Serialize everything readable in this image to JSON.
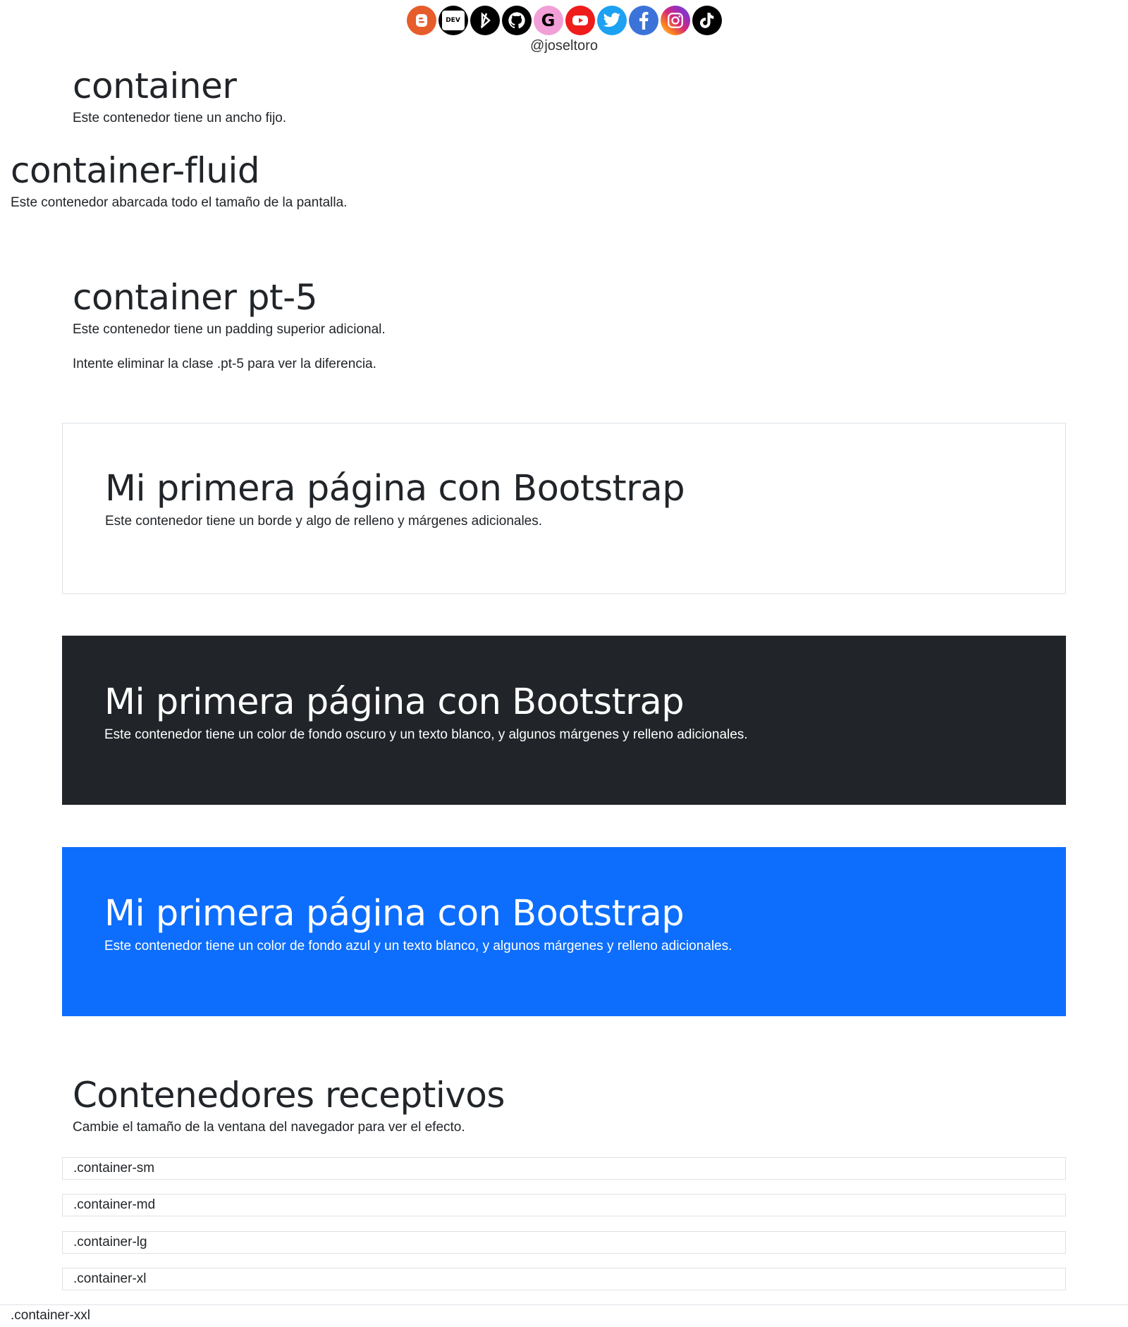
{
  "social": {
    "icons": [
      {
        "name": "blogger-icon",
        "color": "#e65c2b"
      },
      {
        "name": "dev-icon",
        "color": "#000000",
        "text": "DEV"
      },
      {
        "name": "codepen-slash-icon",
        "color": "#000000"
      },
      {
        "name": "github-icon",
        "color": "#000000"
      },
      {
        "name": "google-icon",
        "color": "#f29fd8",
        "text": "G"
      },
      {
        "name": "youtube-icon",
        "color": "#ee1c1b"
      },
      {
        "name": "twitter-icon",
        "color": "#1da1f2"
      },
      {
        "name": "facebook-icon",
        "color": "#3b73d9"
      },
      {
        "name": "instagram-icon",
        "color": "#d62976"
      },
      {
        "name": "tiktok-icon",
        "color": "#000000"
      }
    ],
    "handle": "@joseltoro"
  },
  "sections": {
    "container": {
      "title": "container",
      "text": "Este contenedor tiene un ancho fijo."
    },
    "fluid": {
      "title": "container-fluid",
      "text": "Este contenedor abarcada todo el tamaño de la pantalla."
    },
    "pt5": {
      "title": "container pt-5",
      "text1": "Este contenedor tiene un padding superior adicional.",
      "text2": "Intente eliminar la clase .pt-5 para ver la diferencia."
    },
    "bordered": {
      "title": "Mi primera página con Bootstrap",
      "text": "Este contenedor tiene un borde y algo de relleno y márgenes adicionales."
    },
    "dark": {
      "title": "Mi primera página con Bootstrap",
      "text": "Este contenedor tiene un color de fondo oscuro y un texto blanco, y algunos márgenes y relleno adicionales."
    },
    "blue": {
      "title": "Mi primera página con Bootstrap",
      "text": "Este contenedor tiene un color de fondo azul y un texto blanco, y algunos márgenes y relleno adicionales."
    },
    "responsive": {
      "title": "Contenedores receptivos",
      "text": "Cambie el tamaño de la ventana del navegador para ver el efecto.",
      "rows": [
        ".container-sm",
        ".container-md",
        ".container-lg",
        ".container-xl"
      ],
      "last_row": ".container-xxl"
    }
  },
  "colors": {
    "text": "#212529",
    "dark_bg": "#212529",
    "primary": "#0d6efd",
    "border": "#dee2e6"
  }
}
